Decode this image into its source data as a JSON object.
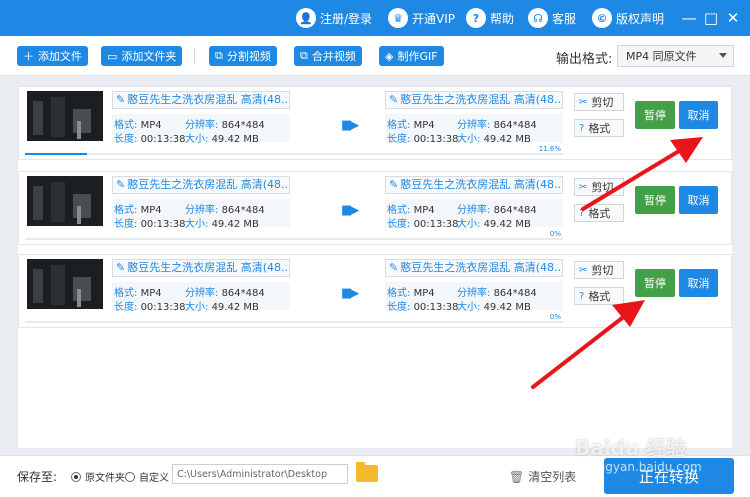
{
  "titlebar": {
    "items": [
      {
        "icon": "user-icon",
        "label": "注册/登录"
      },
      {
        "icon": "crown-icon",
        "label": "开通VIP"
      },
      {
        "icon": "help-icon",
        "label": "帮助"
      },
      {
        "icon": "headset-icon",
        "label": "客服"
      },
      {
        "icon": "copyright-icon",
        "label": "版权声明"
      }
    ],
    "window": {
      "minimize": "—",
      "maximize": "□",
      "close": "✕"
    }
  },
  "toolbar": {
    "add_file": "添加文件",
    "add_folder": "添加文件夹",
    "split_video": "分割视频",
    "merge_video": "合并视频",
    "make_gif": "制作GIF",
    "output_format_label": "输出格式:",
    "output_format_value": "MP4  同原文件"
  },
  "rows": [
    {
      "source": {
        "name": "憨豆先生之洗衣房混乱 高清(48...",
        "format_label": "格式:",
        "format": "MP4",
        "res_label": "分辨率:",
        "resolution": "864*484",
        "dur_label": "长度:",
        "duration": "00:13:38",
        "size_label": "大小:",
        "size": "49.42 MB"
      },
      "target": {
        "name": "憨豆先生之洗衣房混乱 高清(48...",
        "format_label": "格式:",
        "format": "MP4",
        "res_label": "分辨率:",
        "resolution": "864*484",
        "dur_label": "长度:",
        "duration": "00:13:38",
        "size_label": "大小:",
        "size": "49.42 MB"
      },
      "progress": "11.6%",
      "progress_fraction": 0.116,
      "cut_label": "剪切",
      "format_btn_label": "格式",
      "pause_label": "暂停",
      "cancel_label": "取消"
    },
    {
      "source": {
        "name": "憨豆先生之洗衣房混乱 高清(48...",
        "format_label": "格式:",
        "format": "MP4",
        "res_label": "分辨率:",
        "resolution": "864*484",
        "dur_label": "长度:",
        "duration": "00:13:38",
        "size_label": "大小:",
        "size": "49.42 MB"
      },
      "target": {
        "name": "憨豆先生之洗衣房混乱 高清(48...",
        "format_label": "格式:",
        "format": "MP4",
        "res_label": "分辨率:",
        "resolution": "864*484",
        "dur_label": "长度:",
        "duration": "00:13:38",
        "size_label": "大小:",
        "size": "49.42 MB"
      },
      "progress": "0%",
      "progress_fraction": 0,
      "cut_label": "剪切",
      "format_btn_label": "格式",
      "pause_label": "暂停",
      "cancel_label": "取消"
    },
    {
      "source": {
        "name": "憨豆先生之洗衣房混乱 高清(48...",
        "format_label": "格式:",
        "format": "MP4",
        "res_label": "分辨率:",
        "resolution": "864*484",
        "dur_label": "长度:",
        "duration": "00:13:38",
        "size_label": "大小:",
        "size": "49.42 MB"
      },
      "target": {
        "name": "憨豆先生之洗衣房混乱 高清(48...",
        "format_label": "格式:",
        "format": "MP4",
        "res_label": "分辨率:",
        "resolution": "864*484",
        "dur_label": "长度:",
        "duration": "00:13:38",
        "size_label": "大小:",
        "size": "49.42 MB"
      },
      "progress": "0%",
      "progress_fraction": 0,
      "cut_label": "剪切",
      "format_btn_label": "格式",
      "pause_label": "暂停",
      "cancel_label": "取消"
    }
  ],
  "footer": {
    "save_to_label": "保存至:",
    "option_original": "原文件夹",
    "option_custom": "自定义",
    "selected_option": "原文件夹",
    "path_value": "C:\\Users\\Administrator\\Desktop",
    "clear_list": "清空列表",
    "start_label": "正在转换"
  },
  "colors": {
    "accent": "#1e88e5",
    "pause": "#43a047",
    "annotation": "#e8161b"
  },
  "watermark": {
    "line1": "Baidu 经验",
    "line2": "jingyan.baidu.com"
  }
}
